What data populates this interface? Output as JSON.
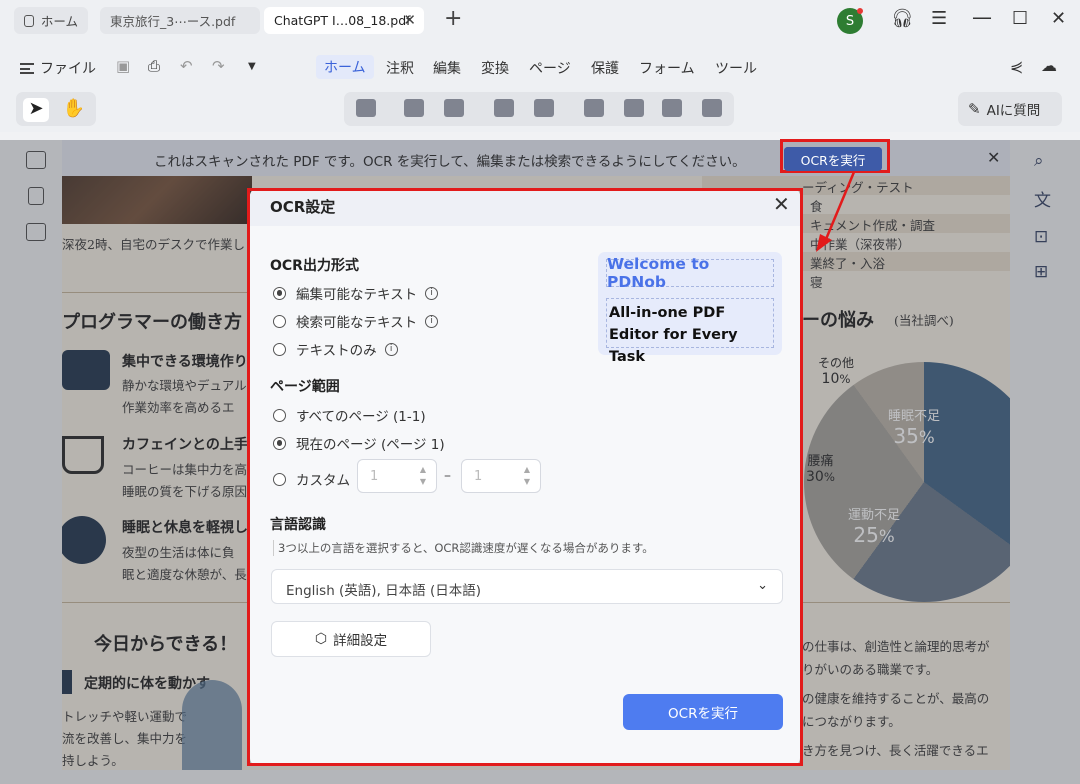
{
  "tabs": {
    "home": "ホーム",
    "doc1": "東京旅行_3⋯ース.pdf",
    "doc2": "ChatGPT I…08_18.pdf",
    "new_tab": "+"
  },
  "user": {
    "avatar_letter": "S"
  },
  "menu": {
    "file": "ファイル",
    "items": [
      "ホーム",
      "注釈",
      "編集",
      "変換",
      "ページ",
      "保護",
      "フォーム",
      "ツール"
    ]
  },
  "toolbar": {
    "ai_button": "AIに質問"
  },
  "banner": {
    "message": "これはスキャンされた PDF です。OCR を実行して、編集または検索できるようにしてください。",
    "ocr_button": "OCRを実行"
  },
  "dialog": {
    "title": "OCR設定",
    "output_format": {
      "label": "OCR出力形式",
      "options": [
        "編集可能なテキスト",
        "検索可能なテキスト",
        "テキストのみ"
      ],
      "selected": "編集可能なテキスト"
    },
    "page_range": {
      "label": "ページ範囲",
      "all": "すべてのページ (1-1)",
      "current": "現在のページ (ページ 1)",
      "custom": "カスタム",
      "from_placeholder": "1",
      "to_placeholder": "1",
      "separator": "–",
      "selected": "現在のページ (ページ 1)"
    },
    "language": {
      "label": "言語認識",
      "hint": "3つ以上の言語を選択すると、OCR認識速度が遅くなる場合があります。",
      "value": "English (英語), 日本語 (日本語)"
    },
    "advanced_button": "詳細設定",
    "run_button": "OCRを実行",
    "promo": {
      "line1": "Welcome to PDNob",
      "line2": "All-in-one PDF Editor for Every Task"
    }
  },
  "document": {
    "caption": "深夜2時、自宅のデスクで作業し",
    "section_heading": "プログラマーの働き方",
    "tips": [
      {
        "title": "集中できる環境作り",
        "body1": "静かな環境やデュアル",
        "body2": "作業効率を高めるエ"
      },
      {
        "title": "カフェインとの上手",
        "body1": "コーヒーは集中力を高",
        "body2": "睡眠の質を下げる原因"
      },
      {
        "title": "睡眠と休息を軽視し",
        "body1": "夜型の生活は体に負",
        "body2": "眠と適度な休憩が、長"
      }
    ],
    "schedule": [
      "ーディング・テスト",
      "食",
      "キュメント作成・調査",
      "中作業（深夜帯）",
      "業終了・入浴",
      "寝"
    ],
    "chart_title": "ーの悩み",
    "chart_source": "(当社調べ)",
    "today_heading": "今日からできる！",
    "exercise_title": "定期的に体を動かす",
    "exercise_body": [
      "トレッチや軽い運動で",
      "流を改善し、集中力を",
      "持しよう。"
    ],
    "closing": [
      "の仕事は、創造性と論理的思考が",
      "りがいのある職業です。",
      "の健康を維持することが、最高の",
      "につながります。",
      "き方を見つけ、長く活躍できるエ"
    ]
  },
  "chart_data": {
    "type": "pie",
    "title": "ーの悩み",
    "subtitle": "(当社調べ)",
    "categories": [
      "睡眠不足",
      "運動不足",
      "腰痛",
      "その他"
    ],
    "values": [
      35,
      25,
      30,
      10
    ],
    "unit": "%",
    "colors": [
      "#4a6b8a",
      "#6f7d8f",
      "#a9a7a0",
      "#bdb7ab"
    ]
  },
  "colors": {
    "accent": "#4e7cf0",
    "annotation_red": "#e21b1b",
    "banner_button": "#3e5ba8"
  }
}
